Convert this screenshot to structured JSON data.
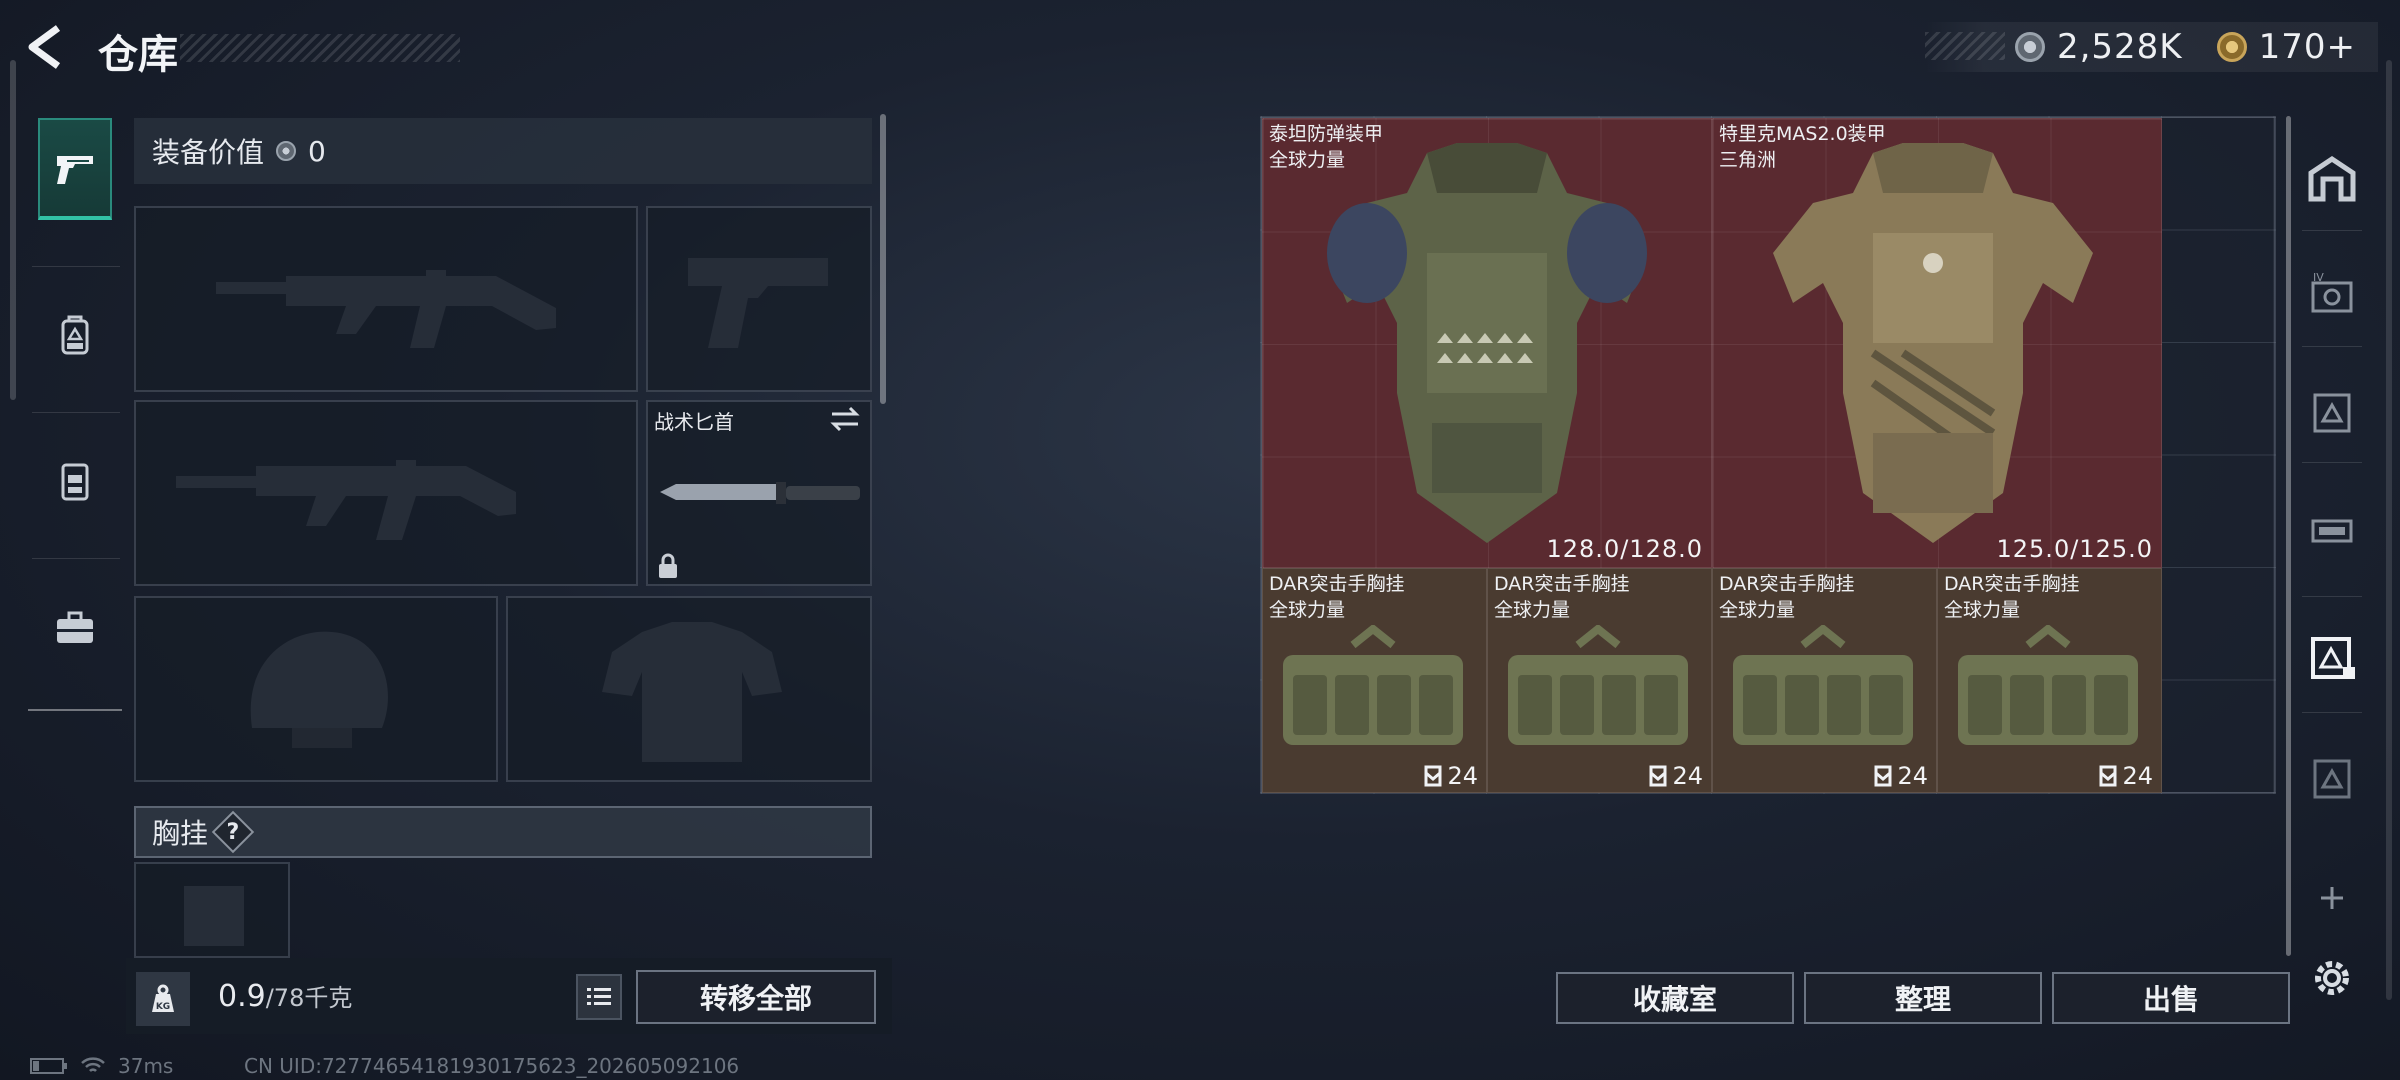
{
  "header": {
    "title": "仓库",
    "currency": [
      {
        "icon": "silver-coin-icon",
        "value": "2,528K"
      },
      {
        "icon": "gold-coin-icon",
        "value": "170+"
      }
    ]
  },
  "left_tabs": [
    {
      "icon": "pistol-icon",
      "active": true
    },
    {
      "icon": "backpack-icon",
      "active": false
    },
    {
      "icon": "chest-rig-icon",
      "active": false
    },
    {
      "icon": "briefcase-icon",
      "active": false
    }
  ],
  "equipment": {
    "value_label": "装备价值",
    "value": "0",
    "knife_slot_label": "战术匕首",
    "chest_rig_section": "胸挂",
    "help": "?",
    "weight_value": "0.9",
    "weight_max": "/78千克",
    "kg_label": "KG",
    "transfer_all": "转移全部"
  },
  "stash": {
    "items": [
      {
        "name": "泰坦防弹装甲",
        "sub": "全球力量",
        "value": "128.0/128.0",
        "type": "armor"
      },
      {
        "name": "特里克MAS2.0装甲",
        "sub": "三角洲",
        "value": "125.0/125.0",
        "type": "armor"
      },
      {
        "name": "DAR突击手胸挂",
        "sub": "全球力量",
        "capacity": "24",
        "type": "rig"
      },
      {
        "name": "DAR突击手胸挂",
        "sub": "全球力量",
        "capacity": "24",
        "type": "rig"
      },
      {
        "name": "DAR突击手胸挂",
        "sub": "全球力量",
        "capacity": "24",
        "type": "rig"
      },
      {
        "name": "DAR突击手胸挂",
        "sub": "全球力量",
        "capacity": "24",
        "type": "rig"
      }
    ],
    "buttons": {
      "collection": "收藏室",
      "organize": "整理",
      "sell": "出售"
    }
  },
  "right_tabs": [
    "building-icon",
    "tier4-box-icon",
    "tier3-box-icon",
    "tier3-rack-icon",
    "tier3-box-selected-icon",
    "tier3-box-icon-2",
    "add-icon",
    "settings-icon"
  ],
  "status": {
    "ping": "37ms",
    "uid": "CN UID:7277465418193017​5623_202605092106"
  },
  "colors": {
    "accent": "#32c2a6",
    "armor_bg": "#5a2a30",
    "rig_bg": "#4a3b30"
  }
}
